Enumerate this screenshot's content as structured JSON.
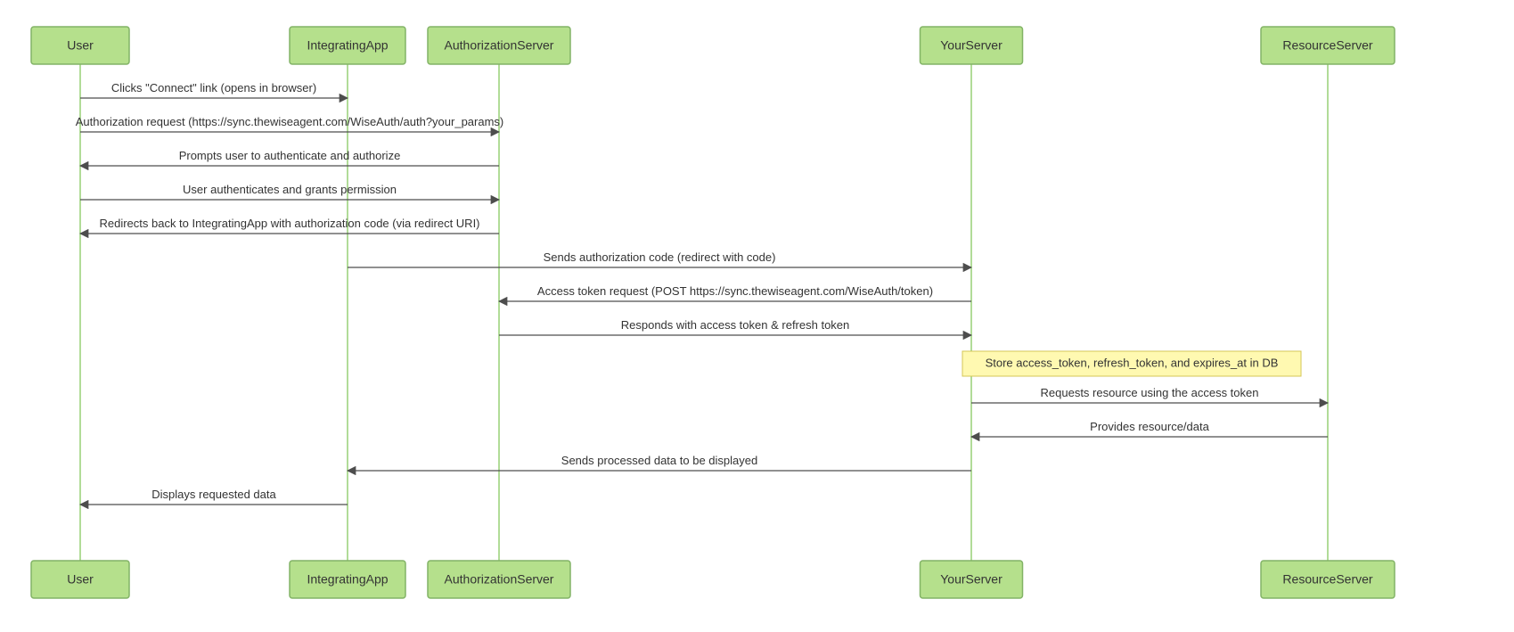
{
  "participants": [
    {
      "id": "user",
      "label": "User"
    },
    {
      "id": "app",
      "label": "IntegratingApp"
    },
    {
      "id": "auth",
      "label": "AuthorizationServer"
    },
    {
      "id": "your",
      "label": "YourServer"
    },
    {
      "id": "res",
      "label": "ResourceServer"
    }
  ],
  "messages": [
    {
      "from": "user",
      "to": "app",
      "label": "Clicks \"Connect\" link (opens in browser)"
    },
    {
      "from": "user",
      "to": "auth",
      "label": "Authorization request (https://sync.thewiseagent.com/WiseAuth/auth?your_params)"
    },
    {
      "from": "auth",
      "to": "user",
      "label": "Prompts user to authenticate and authorize"
    },
    {
      "from": "user",
      "to": "auth",
      "label": "User authenticates and grants permission"
    },
    {
      "from": "auth",
      "to": "user",
      "label": "Redirects back to IntegratingApp with authorization code (via redirect URI)"
    },
    {
      "from": "app",
      "to": "your",
      "label": "Sends authorization code (redirect with code)"
    },
    {
      "from": "your",
      "to": "auth",
      "label": "Access token request (POST https://sync.thewiseagent.com/WiseAuth/token)"
    },
    {
      "from": "auth",
      "to": "your",
      "label": "Responds with access token & refresh token"
    },
    {
      "note_over": "your",
      "label": "Store access_token, refresh_token, and expires_at in DB"
    },
    {
      "from": "your",
      "to": "res",
      "label": "Requests resource using the access token"
    },
    {
      "from": "res",
      "to": "your",
      "label": "Provides resource/data"
    },
    {
      "from": "your",
      "to": "app",
      "label": "Sends processed data to be displayed"
    },
    {
      "from": "app",
      "to": "user",
      "label": "Displays requested data"
    }
  ],
  "colors": {
    "participantFill": "#b5e08c",
    "participantStroke": "#82b366",
    "lifeline": "#97d077",
    "arrow": "#4d4d4d",
    "noteFill": "#fff9b1",
    "noteStroke": "#d4c657"
  }
}
